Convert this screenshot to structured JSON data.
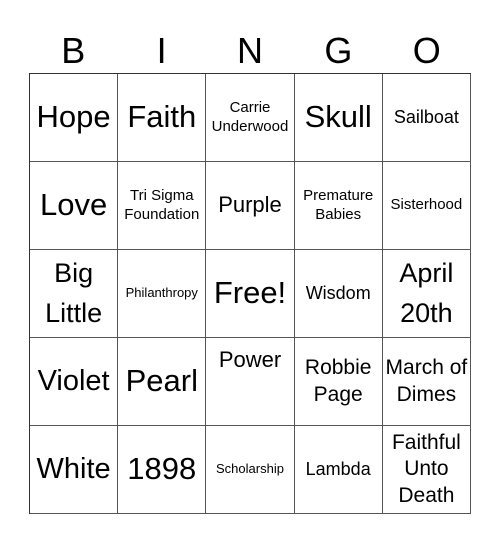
{
  "header": [
    "B",
    "I",
    "N",
    "G",
    "O"
  ],
  "cells": [
    {
      "text": "Hope",
      "size": "s-xl"
    },
    {
      "text": "Faith",
      "size": "s-xl"
    },
    {
      "text": "Carrie Underwood",
      "size": "s-xs"
    },
    {
      "text": "Skull",
      "size": "s-xl"
    },
    {
      "text": "Sailboat",
      "size": "s-sm"
    },
    {
      "text": "Love",
      "size": "s-xl"
    },
    {
      "text": "Tri Sigma Foundation",
      "size": "s-xs"
    },
    {
      "text": "Purple",
      "size": "s-md"
    },
    {
      "text": "Premature Babies",
      "size": "s-xs"
    },
    {
      "text": "Sisterhood",
      "size": "s-xs"
    },
    {
      "text": "Big Little",
      "size": "s-l2"
    },
    {
      "text": "Philanthropy",
      "size": "s-xxs"
    },
    {
      "text": "Free!",
      "size": "s-xl"
    },
    {
      "text": "Wisdom",
      "size": "s-sm"
    },
    {
      "text": "April 20th",
      "size": "s-l2"
    },
    {
      "text": "Violet",
      "size": "s-lg"
    },
    {
      "text": "Pearl",
      "size": "s-xl"
    },
    {
      "text": "Power",
      "size": "s-md",
      "top": true
    },
    {
      "text": "Robbie Page",
      "size": "s-m3"
    },
    {
      "text": "March of Dimes",
      "size": "s-m3"
    },
    {
      "text": "White",
      "size": "s-lg"
    },
    {
      "text": "1898",
      "size": "s-xl"
    },
    {
      "text": "Scholarship",
      "size": "s-xxs"
    },
    {
      "text": "Lambda",
      "size": "s-sm"
    },
    {
      "text": "Faithful Unto Death",
      "size": "s-m3"
    }
  ]
}
